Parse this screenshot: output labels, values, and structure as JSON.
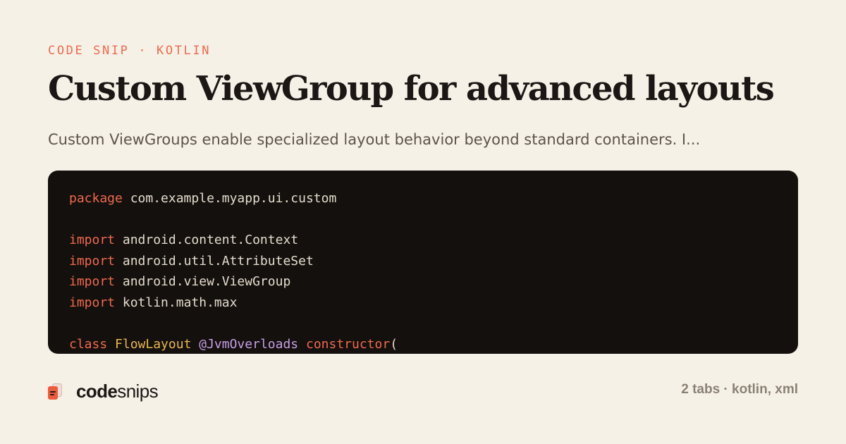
{
  "header": {
    "eyebrow": "CODE SNIP · KOTLIN",
    "title": "Custom ViewGroup for advanced layouts",
    "subtitle": "Custom ViewGroups enable specialized layout behavior beyond standard containers. I..."
  },
  "code": {
    "lines": [
      [
        {
          "t": "package",
          "c": "kw"
        },
        {
          "t": " com.example.myapp.ui.custom",
          "c": "plain"
        }
      ],
      [],
      [
        {
          "t": "import",
          "c": "kw"
        },
        {
          "t": " android.content.Context",
          "c": "plain"
        }
      ],
      [
        {
          "t": "import",
          "c": "kw"
        },
        {
          "t": " android.util.AttributeSet",
          "c": "plain"
        }
      ],
      [
        {
          "t": "import",
          "c": "kw"
        },
        {
          "t": " android.view.ViewGroup",
          "c": "plain"
        }
      ],
      [
        {
          "t": "import",
          "c": "kw"
        },
        {
          "t": " kotlin.math.max",
          "c": "plain"
        }
      ],
      [],
      [
        {
          "t": "class",
          "c": "kw"
        },
        {
          "t": " ",
          "c": "plain"
        },
        {
          "t": "FlowLayout",
          "c": "cls"
        },
        {
          "t": " ",
          "c": "plain"
        },
        {
          "t": "@JvmOverloads",
          "c": "ann"
        },
        {
          "t": " ",
          "c": "plain"
        },
        {
          "t": "constructor",
          "c": "kw"
        },
        {
          "t": "(",
          "c": "plain"
        }
      ]
    ],
    "colors": {
      "background": "#14100d",
      "keyword": "#ef6a4d",
      "class": "#e9b949",
      "annotation": "#c79ee6",
      "plain": "#e4dccd"
    }
  },
  "footer": {
    "brand_strong": "code",
    "brand_light": "snips",
    "brand_icon": "snippet-pages-icon",
    "meta": "2 tabs · kotlin, xml"
  },
  "colors": {
    "page_background": "#f6f1e7",
    "accent": "#ef6a4d",
    "title": "#1b1714",
    "subtitle": "#5c544b",
    "meta": "#8a8175"
  }
}
